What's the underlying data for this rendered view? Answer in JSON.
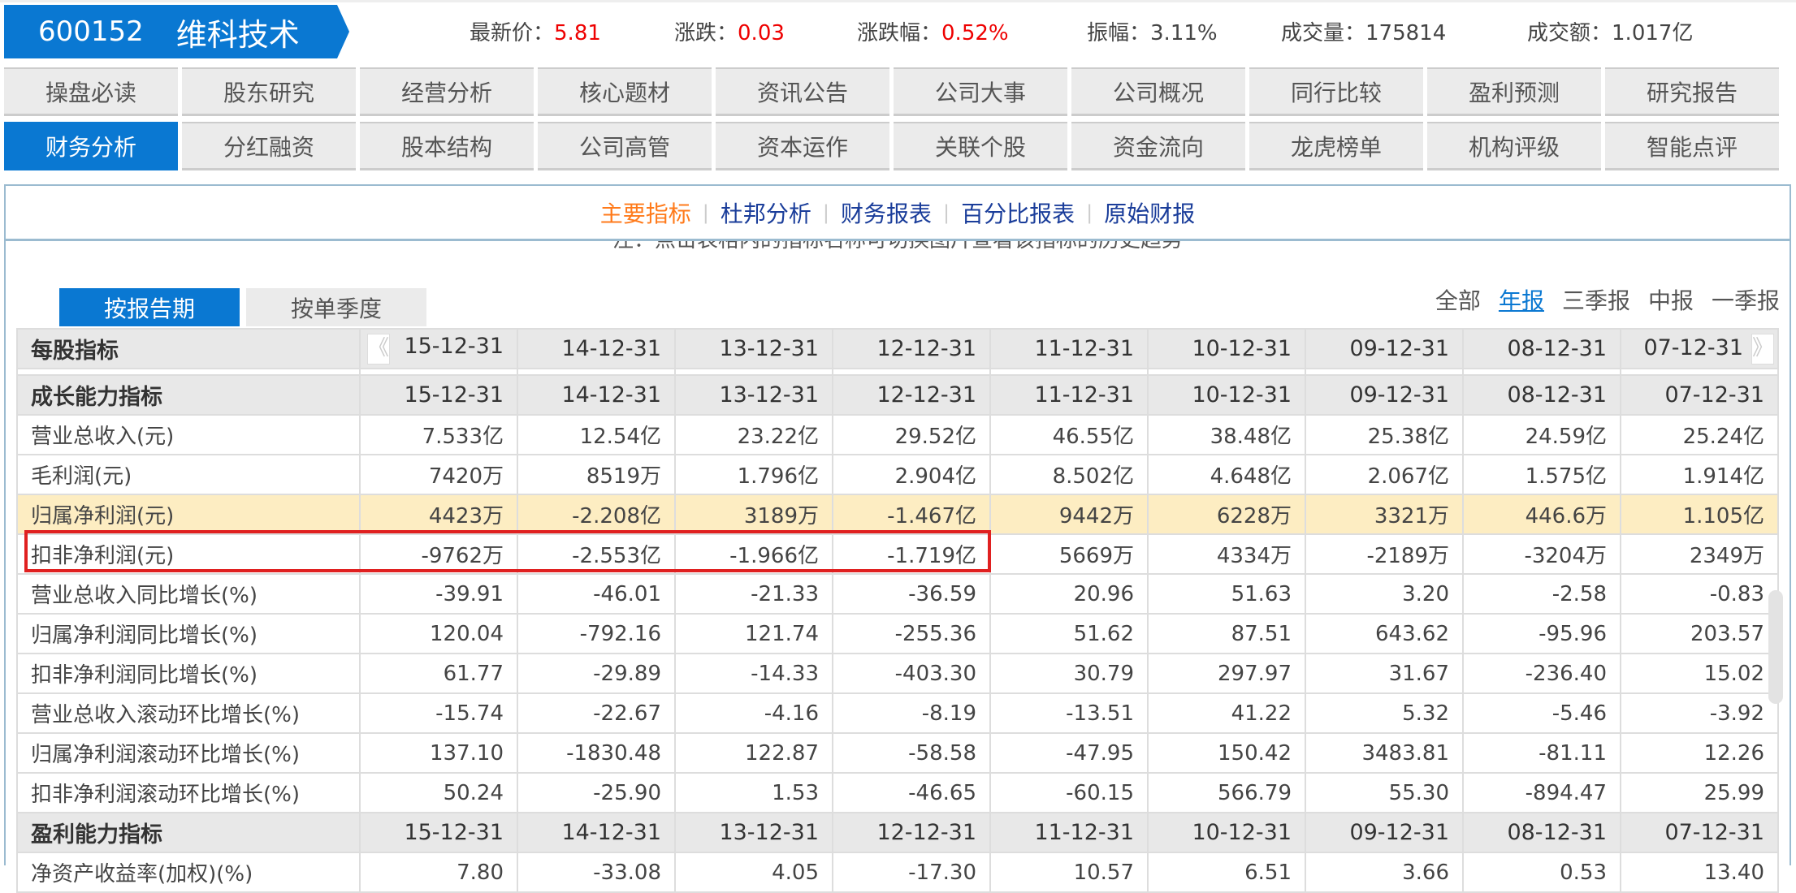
{
  "stock": {
    "code": "600152",
    "name": "维科技术"
  },
  "quote": [
    {
      "label": "最新价：",
      "value": "5.81",
      "red": true
    },
    {
      "label": "涨跌：",
      "value": "0.03",
      "red": true
    },
    {
      "label": "涨跌幅：",
      "value": "0.52%",
      "red": true
    },
    {
      "label": "振幅：",
      "value": "3.11%",
      "red": false
    },
    {
      "label": "成交量：",
      "value": "175814",
      "red": false
    },
    {
      "label": "成交额：",
      "value": "1.017亿",
      "red": false
    }
  ],
  "nav_row1": [
    "操盘必读",
    "股东研究",
    "经营分析",
    "核心题材",
    "资讯公告",
    "公司大事",
    "公司概况",
    "同行比较",
    "盈利预测",
    "研究报告"
  ],
  "nav_row2": [
    "财务分析",
    "分红融资",
    "股本结构",
    "公司高管",
    "资本运作",
    "关联个股",
    "资金流向",
    "龙虎榜单",
    "机构评级",
    "智能点评"
  ],
  "nav_active": "财务分析",
  "subtabs": [
    "主要指标",
    "杜邦分析",
    "财务报表",
    "百分比报表",
    "原始财报"
  ],
  "subtab_active": "主要指标",
  "hint": "注：点击表格内的指标名称可切换图片查看该指标的历史趋势",
  "period_tabs": [
    "按报告期",
    "按单季度"
  ],
  "period_active": "按报告期",
  "filter_tabs": [
    "全部",
    "年报",
    "三季报",
    "中报",
    "一季报"
  ],
  "filter_active": "年报",
  "table": {
    "arrow_prev": "《",
    "arrow_next": "》",
    "dates": [
      "15-12-31",
      "14-12-31",
      "13-12-31",
      "12-12-31",
      "11-12-31",
      "10-12-31",
      "09-12-31",
      "08-12-31",
      "07-12-31"
    ],
    "top_header": "每股指标",
    "rows": [
      {
        "type": "hdr",
        "label": "成长能力指标"
      },
      {
        "label": "营业总收入(元)",
        "values": [
          "7.533亿",
          "12.54亿",
          "23.22亿",
          "29.52亿",
          "46.55亿",
          "38.48亿",
          "25.38亿",
          "24.59亿",
          "25.24亿"
        ]
      },
      {
        "label": "毛利润(元)",
        "values": [
          "7420万",
          "8519万",
          "1.796亿",
          "2.904亿",
          "8.502亿",
          "4.648亿",
          "2.067亿",
          "1.575亿",
          "1.914亿"
        ]
      },
      {
        "label": "归属净利润(元)",
        "highlight": true,
        "values": [
          "4423万",
          "-2.208亿",
          "3189万",
          "-1.467亿",
          "9442万",
          "6228万",
          "3321万",
          "446.6万",
          "1.105亿"
        ]
      },
      {
        "label": "扣非净利润(元)",
        "values": [
          "-9762万",
          "-2.553亿",
          "-1.966亿",
          "-1.719亿",
          "5669万",
          "4334万",
          "-2189万",
          "-3204万",
          "2349万"
        ]
      },
      {
        "label": "营业总收入同比增长(%)",
        "values": [
          "-39.91",
          "-46.01",
          "-21.33",
          "-36.59",
          "20.96",
          "51.63",
          "3.20",
          "-2.58",
          "-0.83"
        ]
      },
      {
        "label": "归属净利润同比增长(%)",
        "values": [
          "120.04",
          "-792.16",
          "121.74",
          "-255.36",
          "51.62",
          "87.51",
          "643.62",
          "-95.96",
          "203.57"
        ]
      },
      {
        "label": "扣非净利润同比增长(%)",
        "values": [
          "61.77",
          "-29.89",
          "-14.33",
          "-403.30",
          "30.79",
          "297.97",
          "31.67",
          "-236.40",
          "15.02"
        ]
      },
      {
        "label": "营业总收入滚动环比增长(%)",
        "values": [
          "-15.74",
          "-22.67",
          "-4.16",
          "-8.19",
          "-13.51",
          "41.22",
          "5.32",
          "-5.46",
          "-3.92"
        ]
      },
      {
        "label": "归属净利润滚动环比增长(%)",
        "values": [
          "137.10",
          "-1830.48",
          "122.87",
          "-58.58",
          "-47.95",
          "150.42",
          "3483.81",
          "-81.11",
          "12.26"
        ]
      },
      {
        "label": "扣非净利润滚动环比增长(%)",
        "values": [
          "50.24",
          "-25.90",
          "1.53",
          "-46.65",
          "-60.15",
          "566.79",
          "55.30",
          "-894.47",
          "25.99"
        ]
      },
      {
        "type": "hdr",
        "label": "盈利能力指标"
      },
      {
        "label": "净资产收益率(加权)(%)",
        "values": [
          "7.80",
          "-33.08",
          "4.05",
          "-17.30",
          "10.57",
          "6.51",
          "3.66",
          "0.53",
          "13.40"
        ]
      }
    ]
  },
  "colors": {
    "brand": "#0a78d2",
    "up": "#ee0000",
    "active_subtab": "#ff7a1a",
    "highlight_row": "#fdedc2",
    "red_box": "#e02020"
  }
}
